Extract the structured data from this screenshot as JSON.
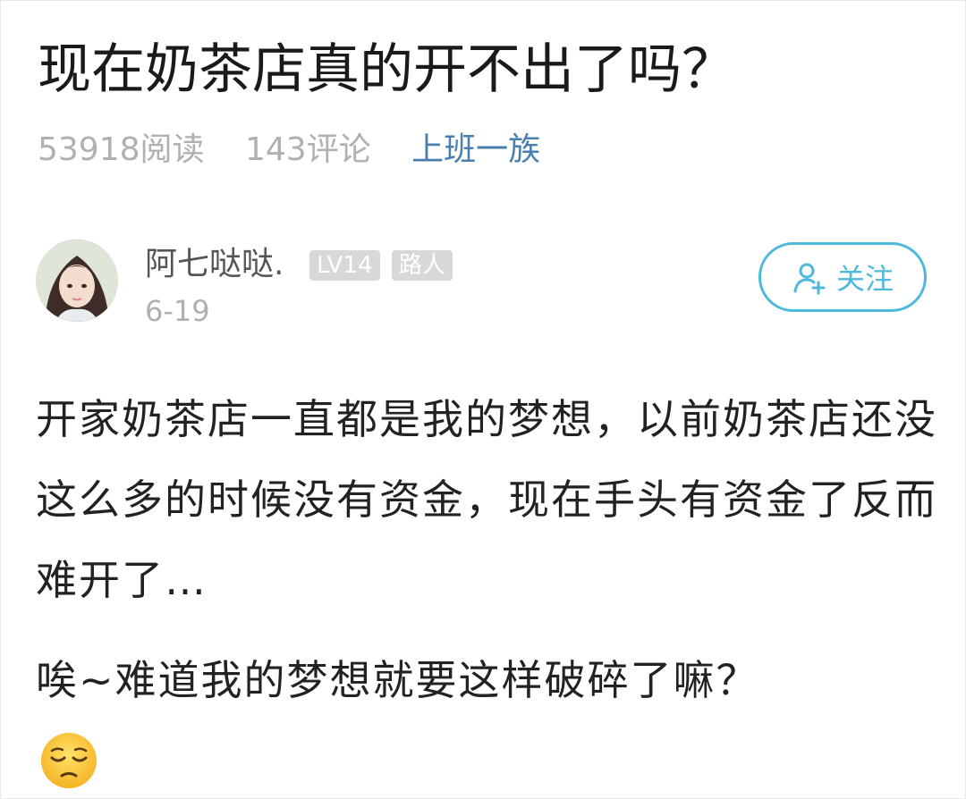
{
  "post": {
    "title": "现在奶茶店真的开不出了吗？",
    "reads": "53918阅读",
    "comments": "143评论",
    "category": "上班一族"
  },
  "author": {
    "name": "阿七哒哒.",
    "level": "LV14",
    "role": "路人",
    "date": "6-19"
  },
  "follow_button": {
    "label": "关注",
    "icon": "add-user-icon",
    "color": "#4fb9dc"
  },
  "content": {
    "paragraph1": "开家奶茶店一直都是我的梦想，以前奶茶店还没这么多的时候没有资金，现在手头有资金了反而难开了…",
    "paragraph2": "唉~难道我的梦想就要这样破碎了嘛？",
    "emoji": "pensive-face-icon"
  },
  "colors": {
    "link": "#4a7eae",
    "muted": "#b0b0b0",
    "badge_bg": "#d8d8d8"
  }
}
